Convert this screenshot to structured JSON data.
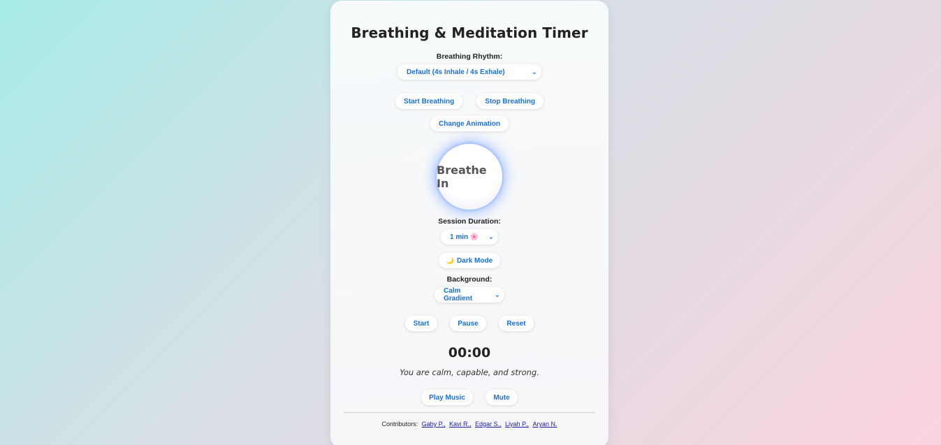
{
  "app": {
    "title": "Breathing & Meditation Timer"
  },
  "rhythm": {
    "label": "Breathing Rhythm:",
    "selected": "Default (4s Inhale / 4s Exhale)"
  },
  "breathing_controls": {
    "start_label": "Start Breathing",
    "stop_label": "Stop Breathing",
    "change_animation_label": "Change Animation"
  },
  "breath_circle": {
    "text": "Breathe In",
    "glow_color": "#7aa0ff"
  },
  "session": {
    "label": "Session Duration:",
    "selected": "1 min 🌸"
  },
  "dark_mode": {
    "icon": "moon-icon",
    "icon_glyph": "🌙",
    "label": "Dark Mode"
  },
  "background": {
    "label": "Background:",
    "selected": "Calm Gradient"
  },
  "timer_controls": {
    "start_label": "Start",
    "pause_label": "Pause",
    "reset_label": "Reset"
  },
  "timer": {
    "display": "00:00"
  },
  "affirmation": {
    "text": "You are calm, capable, and strong."
  },
  "music": {
    "play_label": "Play Music",
    "mute_label": "Mute"
  },
  "footer": {
    "contributors_label": "Contributors:",
    "contributors": [
      "Gaby P.,",
      "Kavi R.,",
      "Edgar S.,",
      "Liyah P.,",
      "Aryan N."
    ]
  },
  "colors": {
    "accent": "#1a6fd1",
    "link": "#1a1aa6",
    "gradient_start": "#a8ece7",
    "gradient_end": "#fbd3df"
  }
}
